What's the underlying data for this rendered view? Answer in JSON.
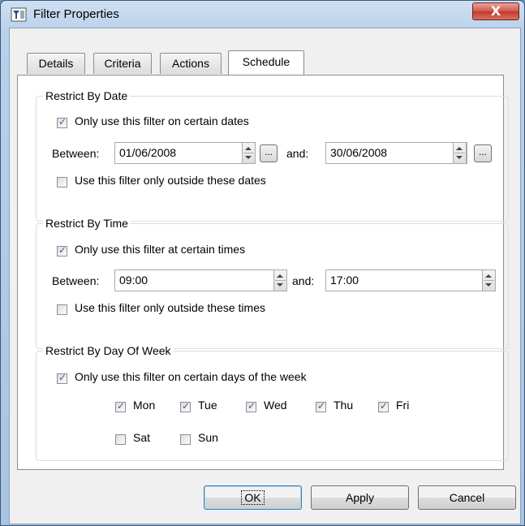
{
  "window": {
    "title": "Filter Properties",
    "close_label": "X"
  },
  "tabs": [
    {
      "label": "Details"
    },
    {
      "label": "Criteria"
    },
    {
      "label": "Actions"
    },
    {
      "label": "Schedule"
    }
  ],
  "date_group": {
    "legend": "Restrict By Date",
    "enable_label": "Only use this filter on certain dates",
    "enable_checked": true,
    "between_label": "Between:",
    "start_value": "01/06/2008",
    "and_label": "and:",
    "end_value": "30/06/2008",
    "browse_label": "...",
    "outside_label": "Use this filter only outside these dates",
    "outside_checked": false
  },
  "time_group": {
    "legend": "Restrict By Time",
    "enable_label": "Only use this filter at certain times",
    "enable_checked": true,
    "between_label": "Between:",
    "start_value": "09:00",
    "and_label": "and:",
    "end_value": "17:00",
    "outside_label": "Use this filter only outside these times",
    "outside_checked": false
  },
  "day_group": {
    "legend": "Restrict By Day Of Week",
    "enable_label": "Only use this filter on certain days of the week",
    "enable_checked": true,
    "days": [
      {
        "label": "Mon",
        "checked": true
      },
      {
        "label": "Tue",
        "checked": true
      },
      {
        "label": "Wed",
        "checked": true
      },
      {
        "label": "Thu",
        "checked": true
      },
      {
        "label": "Fri",
        "checked": true
      },
      {
        "label": "Sat",
        "checked": false
      },
      {
        "label": "Sun",
        "checked": false
      }
    ]
  },
  "buttons": {
    "ok": "OK",
    "apply": "Apply",
    "cancel": "Cancel"
  }
}
